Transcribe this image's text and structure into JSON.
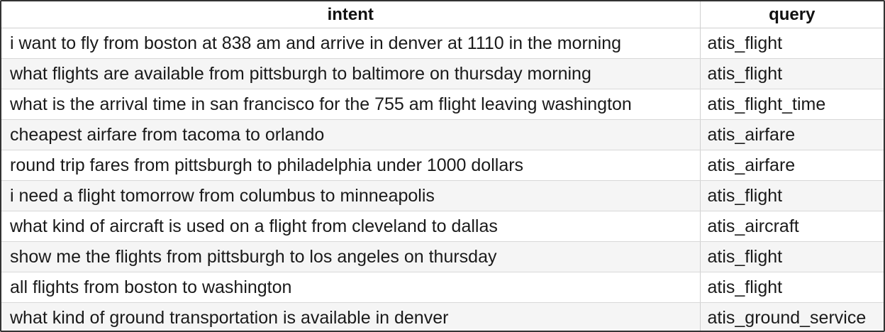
{
  "table": {
    "headers": [
      "intent",
      "query"
    ],
    "rows": [
      {
        "intent": "i want to fly from boston at 838 am and arrive in denver at 1110 in the morning",
        "query": "atis_flight"
      },
      {
        "intent": "what flights are available from pittsburgh to baltimore on thursday morning",
        "query": "atis_flight"
      },
      {
        "intent": "what is the arrival time in san francisco for the 755 am flight leaving washington",
        "query": "atis_flight_time"
      },
      {
        "intent": "cheapest airfare from tacoma to orlando",
        "query": "atis_airfare"
      },
      {
        "intent": "round trip fares from pittsburgh to philadelphia under 1000 dollars",
        "query": "atis_airfare"
      },
      {
        "intent": "i need a flight tomorrow from columbus to minneapolis",
        "query": "atis_flight"
      },
      {
        "intent": "what kind of aircraft is used on a flight from cleveland to dallas",
        "query": "atis_aircraft"
      },
      {
        "intent": "show me the flights from pittsburgh to los angeles on thursday",
        "query": "atis_flight"
      },
      {
        "intent": "all flights from boston to washington",
        "query": "atis_flight"
      },
      {
        "intent": "what kind of ground transportation is available in denver",
        "query": "atis_ground_service"
      }
    ]
  }
}
